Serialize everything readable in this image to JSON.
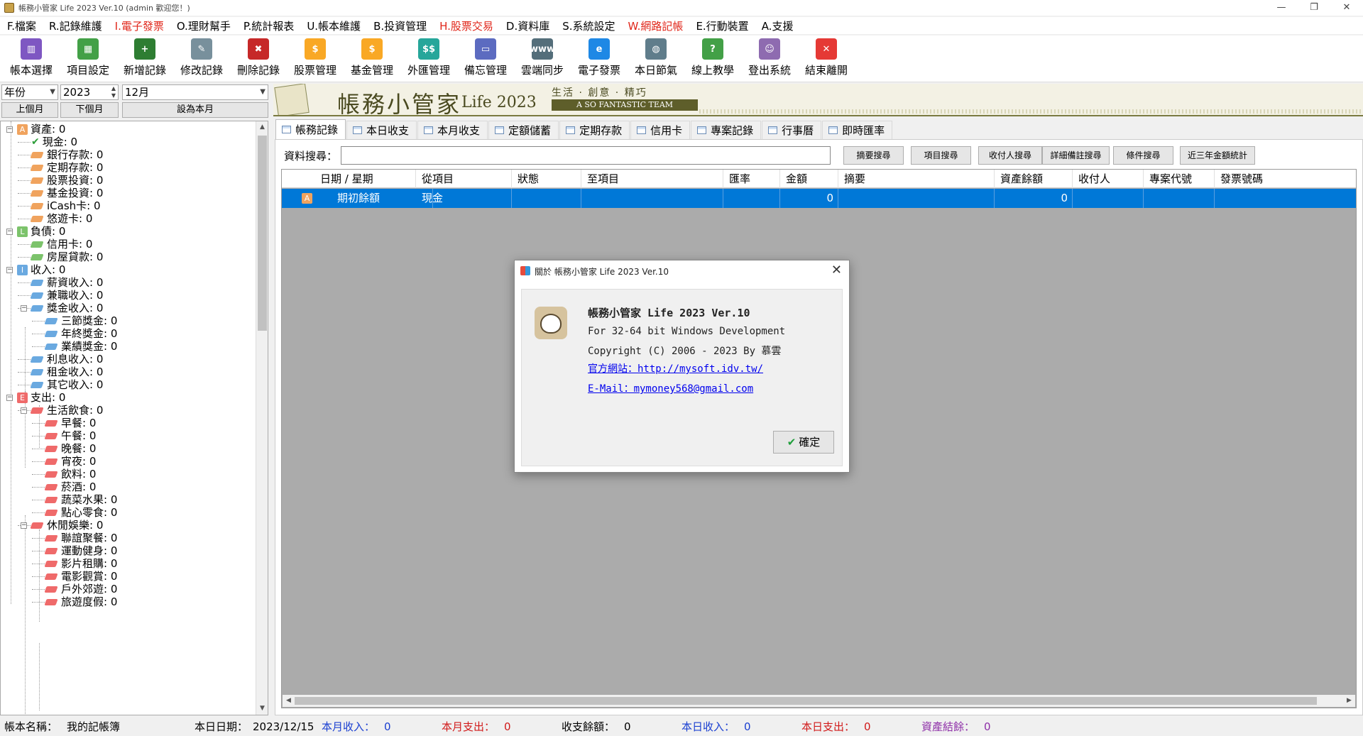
{
  "window": {
    "title": "帳務小管家 Life 2023 Ver.10 (admin 歡迎您！)",
    "controls": [
      "—",
      "❐",
      "✕"
    ]
  },
  "menu": [
    {
      "label": "F.檔案",
      "red": false
    },
    {
      "label": "R.記錄維護",
      "red": false
    },
    {
      "label": "I.電子發票",
      "red": true
    },
    {
      "label": "O.理財幫手",
      "red": false
    },
    {
      "label": "P.統計報表",
      "red": false
    },
    {
      "label": "U.帳本維護",
      "red": false
    },
    {
      "label": "B.投資管理",
      "red": false
    },
    {
      "label": "H.股票交易",
      "red": true
    },
    {
      "label": "D.資料庫",
      "red": false
    },
    {
      "label": "S.系統設定",
      "red": false
    },
    {
      "label": "W.網路記帳",
      "red": true
    },
    {
      "label": "E.行動裝置",
      "red": false
    },
    {
      "label": "A.支援",
      "red": false
    }
  ],
  "toolbar": [
    {
      "label": "帳本選擇",
      "icon": "books-icon",
      "color": "#7e57c2",
      "glyph": "▥"
    },
    {
      "label": "項目設定",
      "icon": "spreadsheet-icon",
      "color": "#43a047",
      "glyph": "▦"
    },
    {
      "label": "新增記錄",
      "icon": "add-record-icon",
      "color": "#2e7d32",
      "glyph": "+"
    },
    {
      "label": "修改記錄",
      "icon": "edit-record-icon",
      "color": "#78909c",
      "glyph": "✎"
    },
    {
      "label": "刪除記錄",
      "icon": "delete-record-icon",
      "color": "#c62828",
      "glyph": "✖"
    },
    {
      "label": "股票管理",
      "icon": "stock-icon",
      "color": "#f9a825",
      "glyph": "$"
    },
    {
      "label": "基金管理",
      "icon": "fund-icon",
      "color": "#f9a825",
      "glyph": "$"
    },
    {
      "label": "外匯管理",
      "icon": "forex-icon",
      "color": "#26a69a",
      "glyph": "$$"
    },
    {
      "label": "備忘管理",
      "icon": "monitor-icon",
      "color": "#5c6bc0",
      "glyph": "▭"
    },
    {
      "label": "雲端同步",
      "icon": "cloud-sync-icon",
      "color": "#546e7a",
      "glyph": "www"
    },
    {
      "label": "電子發票",
      "icon": "einvoice-icon",
      "color": "#1e88e5",
      "glyph": "e"
    },
    {
      "label": "本日節氣",
      "icon": "globe-icon",
      "color": "#607d8b",
      "glyph": "◍"
    },
    {
      "label": "線上教學",
      "icon": "help-icon",
      "color": "#43a047",
      "glyph": "?"
    },
    {
      "label": "登出系統",
      "icon": "users-icon",
      "color": "#8e6bb0",
      "glyph": "☺"
    },
    {
      "label": "結束離開",
      "icon": "exit-icon",
      "color": "#e53935",
      "glyph": "✕"
    }
  ],
  "left": {
    "period_type": "年份",
    "year": "2023",
    "month": "12月",
    "prev_month": "上個月",
    "next_month": "下個月",
    "this_month": "設為本月"
  },
  "tree": [
    {
      "label": "資產: 0",
      "level": 0,
      "kind": "cat",
      "badge": "A",
      "color": "#f0a35e",
      "exp": "−"
    },
    {
      "label": "現金: 0",
      "level": 1,
      "kind": "check",
      "color": "#2e9e3a"
    },
    {
      "label": "銀行存款: 0",
      "level": 1,
      "kind": "tag",
      "color": "#f0a35e"
    },
    {
      "label": "定期存款: 0",
      "level": 1,
      "kind": "tag",
      "color": "#f0a35e"
    },
    {
      "label": "股票投資: 0",
      "level": 1,
      "kind": "tag",
      "color": "#f0a35e"
    },
    {
      "label": "基金投資: 0",
      "level": 1,
      "kind": "tag",
      "color": "#f0a35e"
    },
    {
      "label": "iCash卡: 0",
      "level": 1,
      "kind": "tag",
      "color": "#f0a35e"
    },
    {
      "label": "悠遊卡: 0",
      "level": 1,
      "kind": "tag",
      "color": "#f0a35e"
    },
    {
      "label": "負債: 0",
      "level": 0,
      "kind": "cat",
      "badge": "L",
      "color": "#7cc36b",
      "exp": "−"
    },
    {
      "label": "信用卡: 0",
      "level": 1,
      "kind": "tag",
      "color": "#7cc36b"
    },
    {
      "label": "房屋貸款: 0",
      "level": 1,
      "kind": "tag",
      "color": "#7cc36b"
    },
    {
      "label": "收入: 0",
      "level": 0,
      "kind": "cat",
      "badge": "I",
      "color": "#6aa9e0",
      "exp": "−"
    },
    {
      "label": "薪資收入: 0",
      "level": 1,
      "kind": "tag",
      "color": "#6aa9e0"
    },
    {
      "label": "兼職收入: 0",
      "level": 1,
      "kind": "tag",
      "color": "#6aa9e0"
    },
    {
      "label": "獎金收入: 0",
      "level": 1,
      "kind": "tag",
      "color": "#6aa9e0",
      "exp": "−"
    },
    {
      "label": "三節獎金: 0",
      "level": 2,
      "kind": "tag",
      "color": "#6aa9e0"
    },
    {
      "label": "年終獎金: 0",
      "level": 2,
      "kind": "tag",
      "color": "#6aa9e0"
    },
    {
      "label": "業績獎金: 0",
      "level": 2,
      "kind": "tag",
      "color": "#6aa9e0"
    },
    {
      "label": "利息收入: 0",
      "level": 1,
      "kind": "tag",
      "color": "#6aa9e0"
    },
    {
      "label": "租金收入: 0",
      "level": 1,
      "kind": "tag",
      "color": "#6aa9e0"
    },
    {
      "label": "其它收入: 0",
      "level": 1,
      "kind": "tag",
      "color": "#6aa9e0"
    },
    {
      "label": "支出: 0",
      "level": 0,
      "kind": "cat",
      "badge": "E",
      "color": "#ef6a6a",
      "exp": "−"
    },
    {
      "label": "生活飲食: 0",
      "level": 1,
      "kind": "tag",
      "color": "#ef6a6a",
      "exp": "−"
    },
    {
      "label": "早餐: 0",
      "level": 2,
      "kind": "tag",
      "color": "#ef6a6a"
    },
    {
      "label": "午餐: 0",
      "level": 2,
      "kind": "tag",
      "color": "#ef6a6a"
    },
    {
      "label": "晚餐: 0",
      "level": 2,
      "kind": "tag",
      "color": "#ef6a6a"
    },
    {
      "label": "宵夜: 0",
      "level": 2,
      "kind": "tag",
      "color": "#ef6a6a"
    },
    {
      "label": "飲料: 0",
      "level": 2,
      "kind": "tag",
      "color": "#ef6a6a"
    },
    {
      "label": "菸酒: 0",
      "level": 2,
      "kind": "tag",
      "color": "#ef6a6a"
    },
    {
      "label": "蔬菜水果: 0",
      "level": 2,
      "kind": "tag",
      "color": "#ef6a6a"
    },
    {
      "label": "點心零食: 0",
      "level": 2,
      "kind": "tag",
      "color": "#ef6a6a"
    },
    {
      "label": "休閒娛樂: 0",
      "level": 1,
      "kind": "tag",
      "color": "#ef6a6a",
      "exp": "−"
    },
    {
      "label": "聯誼聚餐: 0",
      "level": 2,
      "kind": "tag",
      "color": "#ef6a6a"
    },
    {
      "label": "運動健身: 0",
      "level": 2,
      "kind": "tag",
      "color": "#ef6a6a"
    },
    {
      "label": "影片租購: 0",
      "level": 2,
      "kind": "tag",
      "color": "#ef6a6a"
    },
    {
      "label": "電影觀賞: 0",
      "level": 2,
      "kind": "tag",
      "color": "#ef6a6a"
    },
    {
      "label": "戶外郊遊: 0",
      "level": 2,
      "kind": "tag",
      "color": "#ef6a6a"
    },
    {
      "label": "旅遊度假: 0",
      "level": 2,
      "kind": "tag",
      "color": "#ef6a6a"
    }
  ],
  "banner": {
    "brand": "帳務小管家",
    "edition": "Life 2023",
    "slogan": "生活 · 創意 · 精巧",
    "team": "A SO FANTASTIC TEAM"
  },
  "tabs": [
    {
      "label": "帳務記錄",
      "active": true
    },
    {
      "label": "本日收支",
      "active": false
    },
    {
      "label": "本月收支",
      "active": false
    },
    {
      "label": "定額儲蓄",
      "active": false
    },
    {
      "label": "定期存款",
      "active": false
    },
    {
      "label": "信用卡",
      "active": false
    },
    {
      "label": "專案記錄",
      "active": false
    },
    {
      "label": "行事曆",
      "active": false
    },
    {
      "label": "即時匯率",
      "active": false
    }
  ],
  "search": {
    "label": "資料搜尋：",
    "value": "",
    "buttons": [
      "摘要搜尋",
      "項目搜尋",
      "收付人搜尋",
      "詳細備註搜尋",
      "條件搜尋",
      "近三年金額統計"
    ]
  },
  "grid": {
    "columns": [
      "日期 / 星期",
      "從項目",
      "狀態",
      "至項目",
      "匯率",
      "金額",
      "摘要",
      "資產餘額",
      "收付人",
      "專案代號",
      "發票號碼"
    ],
    "rows": [
      {
        "badge": "A",
        "cells": [
          "期初餘額",
          "現金",
          "",
          "",
          "",
          "0",
          "",
          "0",
          "",
          "",
          ""
        ]
      }
    ]
  },
  "dialog": {
    "title": "關於 帳務小管家 Life 2023 Ver.10",
    "product": "帳務小管家 Life 2023 Ver.10",
    "platform": "For 32-64 bit Windows Development",
    "copyright": "Copyright (C) 2006 - 2023 By 慕雲",
    "website": "官方網站：http://mysoft.idv.tw/",
    "email": "E-Mail：mymoney568@gmail.com",
    "ok": "確定"
  },
  "status": {
    "book_label": "帳本名稱：",
    "book_value": "我的記帳簿",
    "date_label": "本日日期：",
    "date_value": "2023/12/15",
    "month_income_label": "本月收入：",
    "month_income_value": "0",
    "month_expense_label": "本月支出：",
    "month_expense_value": "0",
    "balance_label": "收支餘額：",
    "balance_value": "0",
    "day_income_label": "本日收入：",
    "day_income_value": "0",
    "day_expense_label": "本日支出：",
    "day_expense_value": "0",
    "asset_label": "資產結餘：",
    "asset_value": "0",
    "income_color": "#1a3fd1",
    "expense_color": "#d11a1a",
    "asset_color": "#8e2fa8"
  }
}
